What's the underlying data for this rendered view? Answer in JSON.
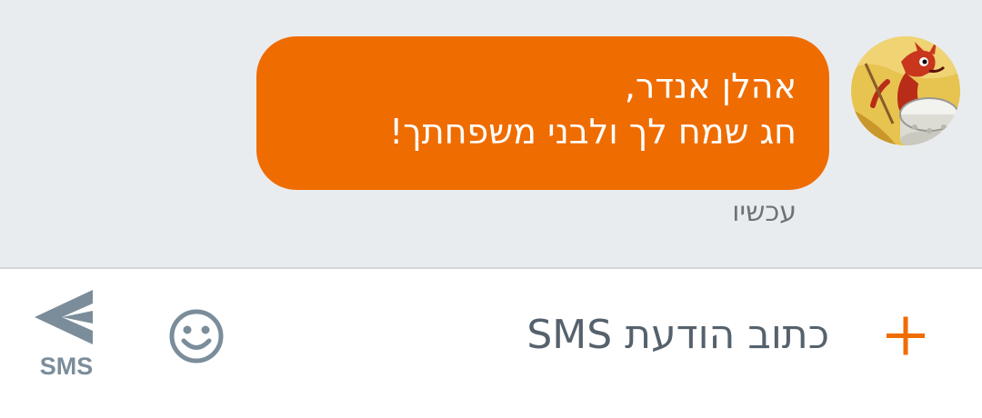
{
  "conversation": {
    "message": {
      "line1": "אהלן אנדר,",
      "line2": "חג שמח לך ולבני משפחתך!",
      "timestamp": "עכשיו"
    }
  },
  "composer": {
    "placeholder": "כתוב הודעת SMS",
    "send_label": "SMS"
  },
  "icons": {
    "add": "plus-icon",
    "emoji": "smiley-icon",
    "send": "send-arrow-icon",
    "avatar": "contact-avatar"
  },
  "colors": {
    "bubble": "#ef6c00",
    "accent": "#ef6c00",
    "thread_background": "#e9ecef",
    "icon_gray": "#7b8d9a"
  }
}
